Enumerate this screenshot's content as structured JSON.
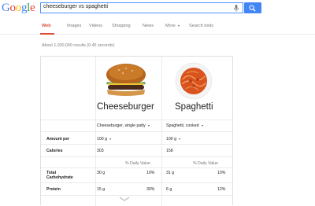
{
  "logo": {
    "letters": [
      "G",
      "o",
      "o",
      "g",
      "l",
      "e"
    ],
    "colors": [
      "#4285f4",
      "#ea4335",
      "#fbbc05",
      "#4285f4",
      "#34a853",
      "#ea4335"
    ]
  },
  "search": {
    "query": "cheeseburger vs spaghetti"
  },
  "tabs": [
    {
      "label": "Web",
      "active": true
    },
    {
      "label": "Images"
    },
    {
      "label": "Videos"
    },
    {
      "label": "Shopping"
    },
    {
      "label": "News"
    },
    {
      "label": "More"
    },
    {
      "label": "Search tools"
    }
  ],
  "results_count": "About 1,930,000 results (0.45 seconds)",
  "comparison": {
    "foods": [
      {
        "name": "Cheeseburger",
        "serving": "Cheeseburger, single patty",
        "amount": "100 g",
        "calories": "303",
        "carb_g": "30 g",
        "carb_dv": "10%",
        "protein_g": "15 g",
        "protein_dv": "30%"
      },
      {
        "name": "Spaghetti",
        "serving": "Spaghetti, cooked",
        "amount": "100 g",
        "calories": "158",
        "carb_g": "31 g",
        "carb_dv": "10%",
        "protein_g": "6 g",
        "protein_dv": "12%"
      }
    ],
    "labels": {
      "amount_per": "Amount per",
      "calories": "Calories",
      "daily_value": "% Daily Value",
      "total_carb_line1": "Total",
      "total_carb_line2": "Carbohydrate",
      "protein": "Protein"
    }
  },
  "colors": {
    "accent": "#dd4b39",
    "search_blue": "#4285f4"
  }
}
